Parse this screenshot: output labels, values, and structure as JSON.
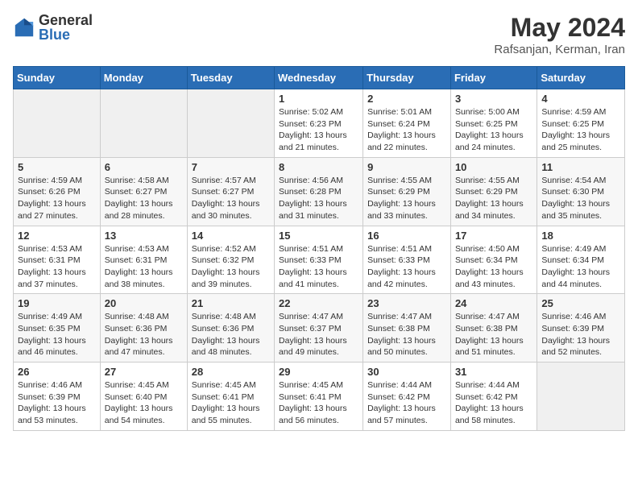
{
  "header": {
    "logo": {
      "general": "General",
      "blue": "Blue"
    },
    "title": "May 2024",
    "subtitle": "Rafsanjan, Kerman, Iran"
  },
  "weekdays": [
    "Sunday",
    "Monday",
    "Tuesday",
    "Wednesday",
    "Thursday",
    "Friday",
    "Saturday"
  ],
  "weeks": [
    [
      {
        "day": "",
        "info": ""
      },
      {
        "day": "",
        "info": ""
      },
      {
        "day": "",
        "info": ""
      },
      {
        "day": "1",
        "info": "Sunrise: 5:02 AM\nSunset: 6:23 PM\nDaylight: 13 hours\nand 21 minutes."
      },
      {
        "day": "2",
        "info": "Sunrise: 5:01 AM\nSunset: 6:24 PM\nDaylight: 13 hours\nand 22 minutes."
      },
      {
        "day": "3",
        "info": "Sunrise: 5:00 AM\nSunset: 6:25 PM\nDaylight: 13 hours\nand 24 minutes."
      },
      {
        "day": "4",
        "info": "Sunrise: 4:59 AM\nSunset: 6:25 PM\nDaylight: 13 hours\nand 25 minutes."
      }
    ],
    [
      {
        "day": "5",
        "info": "Sunrise: 4:59 AM\nSunset: 6:26 PM\nDaylight: 13 hours\nand 27 minutes."
      },
      {
        "day": "6",
        "info": "Sunrise: 4:58 AM\nSunset: 6:27 PM\nDaylight: 13 hours\nand 28 minutes."
      },
      {
        "day": "7",
        "info": "Sunrise: 4:57 AM\nSunset: 6:27 PM\nDaylight: 13 hours\nand 30 minutes."
      },
      {
        "day": "8",
        "info": "Sunrise: 4:56 AM\nSunset: 6:28 PM\nDaylight: 13 hours\nand 31 minutes."
      },
      {
        "day": "9",
        "info": "Sunrise: 4:55 AM\nSunset: 6:29 PM\nDaylight: 13 hours\nand 33 minutes."
      },
      {
        "day": "10",
        "info": "Sunrise: 4:55 AM\nSunset: 6:29 PM\nDaylight: 13 hours\nand 34 minutes."
      },
      {
        "day": "11",
        "info": "Sunrise: 4:54 AM\nSunset: 6:30 PM\nDaylight: 13 hours\nand 35 minutes."
      }
    ],
    [
      {
        "day": "12",
        "info": "Sunrise: 4:53 AM\nSunset: 6:31 PM\nDaylight: 13 hours\nand 37 minutes."
      },
      {
        "day": "13",
        "info": "Sunrise: 4:53 AM\nSunset: 6:31 PM\nDaylight: 13 hours\nand 38 minutes."
      },
      {
        "day": "14",
        "info": "Sunrise: 4:52 AM\nSunset: 6:32 PM\nDaylight: 13 hours\nand 39 minutes."
      },
      {
        "day": "15",
        "info": "Sunrise: 4:51 AM\nSunset: 6:33 PM\nDaylight: 13 hours\nand 41 minutes."
      },
      {
        "day": "16",
        "info": "Sunrise: 4:51 AM\nSunset: 6:33 PM\nDaylight: 13 hours\nand 42 minutes."
      },
      {
        "day": "17",
        "info": "Sunrise: 4:50 AM\nSunset: 6:34 PM\nDaylight: 13 hours\nand 43 minutes."
      },
      {
        "day": "18",
        "info": "Sunrise: 4:49 AM\nSunset: 6:34 PM\nDaylight: 13 hours\nand 44 minutes."
      }
    ],
    [
      {
        "day": "19",
        "info": "Sunrise: 4:49 AM\nSunset: 6:35 PM\nDaylight: 13 hours\nand 46 minutes."
      },
      {
        "day": "20",
        "info": "Sunrise: 4:48 AM\nSunset: 6:36 PM\nDaylight: 13 hours\nand 47 minutes."
      },
      {
        "day": "21",
        "info": "Sunrise: 4:48 AM\nSunset: 6:36 PM\nDaylight: 13 hours\nand 48 minutes."
      },
      {
        "day": "22",
        "info": "Sunrise: 4:47 AM\nSunset: 6:37 PM\nDaylight: 13 hours\nand 49 minutes."
      },
      {
        "day": "23",
        "info": "Sunrise: 4:47 AM\nSunset: 6:38 PM\nDaylight: 13 hours\nand 50 minutes."
      },
      {
        "day": "24",
        "info": "Sunrise: 4:47 AM\nSunset: 6:38 PM\nDaylight: 13 hours\nand 51 minutes."
      },
      {
        "day": "25",
        "info": "Sunrise: 4:46 AM\nSunset: 6:39 PM\nDaylight: 13 hours\nand 52 minutes."
      }
    ],
    [
      {
        "day": "26",
        "info": "Sunrise: 4:46 AM\nSunset: 6:39 PM\nDaylight: 13 hours\nand 53 minutes."
      },
      {
        "day": "27",
        "info": "Sunrise: 4:45 AM\nSunset: 6:40 PM\nDaylight: 13 hours\nand 54 minutes."
      },
      {
        "day": "28",
        "info": "Sunrise: 4:45 AM\nSunset: 6:41 PM\nDaylight: 13 hours\nand 55 minutes."
      },
      {
        "day": "29",
        "info": "Sunrise: 4:45 AM\nSunset: 6:41 PM\nDaylight: 13 hours\nand 56 minutes."
      },
      {
        "day": "30",
        "info": "Sunrise: 4:44 AM\nSunset: 6:42 PM\nDaylight: 13 hours\nand 57 minutes."
      },
      {
        "day": "31",
        "info": "Sunrise: 4:44 AM\nSunset: 6:42 PM\nDaylight: 13 hours\nand 58 minutes."
      },
      {
        "day": "",
        "info": ""
      }
    ]
  ]
}
